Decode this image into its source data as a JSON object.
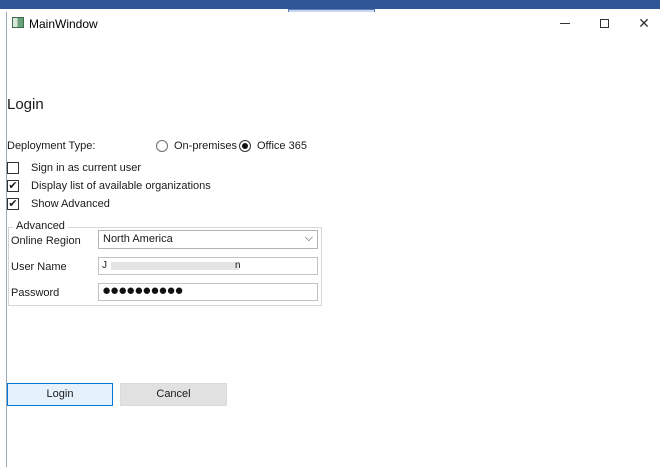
{
  "window": {
    "title": "MainWindow",
    "minimize_glyph": "—",
    "close_glyph": "✕"
  },
  "form": {
    "heading": "Login",
    "deployment_type_label": "Deployment Type:",
    "deployment_options": [
      {
        "label": "On-premises",
        "checked": false
      },
      {
        "label": "Office 365",
        "checked": true
      }
    ],
    "checkboxes": [
      {
        "label": "Sign in as current user",
        "checked": false
      },
      {
        "label": "Display list of available organizations",
        "checked": true
      },
      {
        "label": "Show Advanced",
        "checked": true
      }
    ],
    "check_glyph": "✔",
    "advanced": {
      "title": "Advanced",
      "online_region_label": "Online Region",
      "online_region_value": "North America",
      "user_name_label": "User Name",
      "user_name_value_start": "J",
      "user_name_value_end": "n",
      "password_label": "Password",
      "password_value": "●●●●●●●●●●"
    },
    "buttons": {
      "login": "Login",
      "cancel": "Cancel"
    }
  },
  "icons": {
    "app": "window-app-icon",
    "combo_arrow": "chevron-down-icon",
    "chevron_glyph": "⌵"
  }
}
